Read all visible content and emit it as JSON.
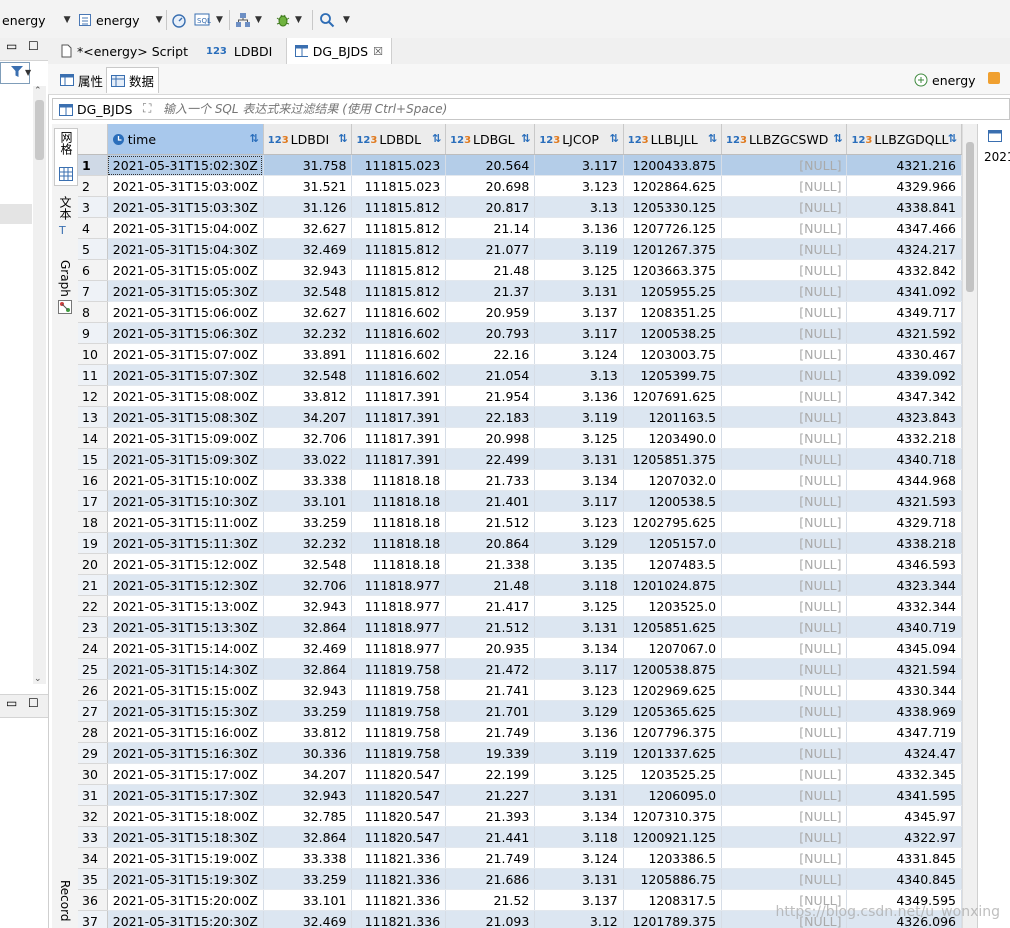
{
  "toolbar": {
    "connection_label": "energy",
    "schema_label": "energy"
  },
  "tabs": [
    {
      "label": "*<energy> Script"
    },
    {
      "label": "LDBDI"
    },
    {
      "label": "DG_BJDS"
    }
  ],
  "subtabs": {
    "properties": "属性",
    "data": "数据",
    "connection": "energy"
  },
  "filter": {
    "table_name": "DG_BJDS",
    "placeholder": "输入一个 SQL 表达式来过滤结果 (使用 Ctrl+Space)"
  },
  "side_tabs": {
    "grid": "网格",
    "text": "文本",
    "graph": "Graph",
    "record": "Record"
  },
  "right_panel": {
    "value_preview": "2021"
  },
  "watermark": "https://blog.csdn.net/u_wonxing",
  "colors": {
    "selected_row": "#b4cde8",
    "alt_row": "#dce6f1",
    "header_bg": "#ececec",
    "null_text": "#aaaaaa",
    "accent_blue": "#2a6ebb"
  },
  "grid": {
    "columns": [
      "time",
      "LDBDI",
      "LDBDL",
      "LDBGL",
      "LJCOP",
      "LLBLJLL",
      "LLBZGCSWD",
      "LLBZGDQLL"
    ],
    "rows": [
      [
        "1",
        "2021-05-31T15:02:30Z",
        "31.758",
        "111815.023",
        "20.564",
        "3.117",
        "1200433.875",
        "[NULL]",
        "4321.216"
      ],
      [
        "2",
        "2021-05-31T15:03:00Z",
        "31.521",
        "111815.023",
        "20.698",
        "3.123",
        "1202864.625",
        "[NULL]",
        "4329.966"
      ],
      [
        "3",
        "2021-05-31T15:03:30Z",
        "31.126",
        "111815.812",
        "20.817",
        "3.13",
        "1205330.125",
        "[NULL]",
        "4338.841"
      ],
      [
        "4",
        "2021-05-31T15:04:00Z",
        "32.627",
        "111815.812",
        "21.14",
        "3.136",
        "1207726.125",
        "[NULL]",
        "4347.466"
      ],
      [
        "5",
        "2021-05-31T15:04:30Z",
        "32.469",
        "111815.812",
        "21.077",
        "3.119",
        "1201267.375",
        "[NULL]",
        "4324.217"
      ],
      [
        "6",
        "2021-05-31T15:05:00Z",
        "32.943",
        "111815.812",
        "21.48",
        "3.125",
        "1203663.375",
        "[NULL]",
        "4332.842"
      ],
      [
        "7",
        "2021-05-31T15:05:30Z",
        "32.548",
        "111815.812",
        "21.37",
        "3.131",
        "1205955.25",
        "[NULL]",
        "4341.092"
      ],
      [
        "8",
        "2021-05-31T15:06:00Z",
        "32.627",
        "111816.602",
        "20.959",
        "3.137",
        "1208351.25",
        "[NULL]",
        "4349.717"
      ],
      [
        "9",
        "2021-05-31T15:06:30Z",
        "32.232",
        "111816.602",
        "20.793",
        "3.117",
        "1200538.25",
        "[NULL]",
        "4321.592"
      ],
      [
        "10",
        "2021-05-31T15:07:00Z",
        "33.891",
        "111816.602",
        "22.16",
        "3.124",
        "1203003.75",
        "[NULL]",
        "4330.467"
      ],
      [
        "11",
        "2021-05-31T15:07:30Z",
        "32.548",
        "111816.602",
        "21.054",
        "3.13",
        "1205399.75",
        "[NULL]",
        "4339.092"
      ],
      [
        "12",
        "2021-05-31T15:08:00Z",
        "33.812",
        "111817.391",
        "21.954",
        "3.136",
        "1207691.625",
        "[NULL]",
        "4347.342"
      ],
      [
        "13",
        "2021-05-31T15:08:30Z",
        "34.207",
        "111817.391",
        "22.183",
        "3.119",
        "1201163.5",
        "[NULL]",
        "4323.843"
      ],
      [
        "14",
        "2021-05-31T15:09:00Z",
        "32.706",
        "111817.391",
        "20.998",
        "3.125",
        "1203490.0",
        "[NULL]",
        "4332.218"
      ],
      [
        "15",
        "2021-05-31T15:09:30Z",
        "33.022",
        "111817.391",
        "22.499",
        "3.131",
        "1205851.375",
        "[NULL]",
        "4340.718"
      ],
      [
        "16",
        "2021-05-31T15:10:00Z",
        "33.338",
        "111818.18",
        "21.733",
        "3.134",
        "1207032.0",
        "[NULL]",
        "4344.968"
      ],
      [
        "17",
        "2021-05-31T15:10:30Z",
        "33.101",
        "111818.18",
        "21.401",
        "3.117",
        "1200538.5",
        "[NULL]",
        "4321.593"
      ],
      [
        "18",
        "2021-05-31T15:11:00Z",
        "33.259",
        "111818.18",
        "21.512",
        "3.123",
        "1202795.625",
        "[NULL]",
        "4329.718"
      ],
      [
        "19",
        "2021-05-31T15:11:30Z",
        "32.232",
        "111818.18",
        "20.864",
        "3.129",
        "1205157.0",
        "[NULL]",
        "4338.218"
      ],
      [
        "20",
        "2021-05-31T15:12:00Z",
        "32.548",
        "111818.18",
        "21.338",
        "3.135",
        "1207483.5",
        "[NULL]",
        "4346.593"
      ],
      [
        "21",
        "2021-05-31T15:12:30Z",
        "32.706",
        "111818.977",
        "21.48",
        "3.118",
        "1201024.875",
        "[NULL]",
        "4323.344"
      ],
      [
        "22",
        "2021-05-31T15:13:00Z",
        "32.943",
        "111818.977",
        "21.417",
        "3.125",
        "1203525.0",
        "[NULL]",
        "4332.344"
      ],
      [
        "23",
        "2021-05-31T15:13:30Z",
        "32.864",
        "111818.977",
        "21.512",
        "3.131",
        "1205851.625",
        "[NULL]",
        "4340.719"
      ],
      [
        "24",
        "2021-05-31T15:14:00Z",
        "32.469",
        "111818.977",
        "20.935",
        "3.134",
        "1207067.0",
        "[NULL]",
        "4345.094"
      ],
      [
        "25",
        "2021-05-31T15:14:30Z",
        "32.864",
        "111819.758",
        "21.472",
        "3.117",
        "1200538.875",
        "[NULL]",
        "4321.594"
      ],
      [
        "26",
        "2021-05-31T15:15:00Z",
        "32.943",
        "111819.758",
        "21.741",
        "3.123",
        "1202969.625",
        "[NULL]",
        "4330.344"
      ],
      [
        "27",
        "2021-05-31T15:15:30Z",
        "33.259",
        "111819.758",
        "21.701",
        "3.129",
        "1205365.625",
        "[NULL]",
        "4338.969"
      ],
      [
        "28",
        "2021-05-31T15:16:00Z",
        "33.812",
        "111819.758",
        "21.749",
        "3.136",
        "1207796.375",
        "[NULL]",
        "4347.719"
      ],
      [
        "29",
        "2021-05-31T15:16:30Z",
        "30.336",
        "111819.758",
        "19.339",
        "3.119",
        "1201337.625",
        "[NULL]",
        "4324.47"
      ],
      [
        "30",
        "2021-05-31T15:17:00Z",
        "34.207",
        "111820.547",
        "22.199",
        "3.125",
        "1203525.25",
        "[NULL]",
        "4332.345"
      ],
      [
        "31",
        "2021-05-31T15:17:30Z",
        "32.943",
        "111820.547",
        "21.227",
        "3.131",
        "1206095.0",
        "[NULL]",
        "4341.595"
      ],
      [
        "32",
        "2021-05-31T15:18:00Z",
        "32.785",
        "111820.547",
        "21.393",
        "3.134",
        "1207310.375",
        "[NULL]",
        "4345.97"
      ],
      [
        "33",
        "2021-05-31T15:18:30Z",
        "32.864",
        "111820.547",
        "21.441",
        "3.118",
        "1200921.125",
        "[NULL]",
        "4322.97"
      ],
      [
        "34",
        "2021-05-31T15:19:00Z",
        "33.338",
        "111821.336",
        "21.749",
        "3.124",
        "1203386.5",
        "[NULL]",
        "4331.845"
      ],
      [
        "35",
        "2021-05-31T15:19:30Z",
        "33.259",
        "111821.336",
        "21.686",
        "3.131",
        "1205886.75",
        "[NULL]",
        "4340.845"
      ],
      [
        "36",
        "2021-05-31T15:20:00Z",
        "33.101",
        "111821.336",
        "21.52",
        "3.137",
        "1208317.5",
        "[NULL]",
        "4349.595"
      ],
      [
        "37",
        "2021-05-31T15:20:30Z",
        "32.469",
        "111821.336",
        "21.093",
        "3.12",
        "1201789.375",
        "[NULL]",
        "4326.096"
      ]
    ]
  }
}
